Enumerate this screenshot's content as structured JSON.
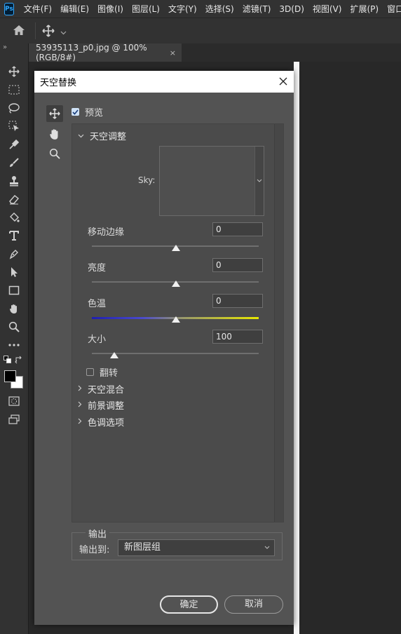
{
  "app": {
    "logo_text": "Ps",
    "menus": [
      "文件(F)",
      "编辑(E)",
      "图像(I)",
      "图层(L)",
      "文字(Y)",
      "选择(S)",
      "滤镜(T)",
      "3D(D)",
      "视图(V)",
      "扩展(P)",
      "窗口(W)"
    ]
  },
  "toolbar": {
    "collapse_glyph": "»",
    "tools": [
      "move-tool",
      "marquee-tool",
      "lasso-tool",
      "object-select-tool",
      "eyedropper-tool",
      "brush-tool",
      "stamp-tool",
      "eraser-tool",
      "paint-bucket-tool",
      "type-tool",
      "pen-tool",
      "path-select-tool",
      "rectangle-tool",
      "hand-tool",
      "zoom-tool",
      "more-tools",
      "quick-mask",
      "screen-mode"
    ],
    "foreground_color": "#000000",
    "background_color": "#ffffff"
  },
  "document": {
    "tab_title": "53935113_p0.jpg @ 100%(RGB/8#)",
    "close_glyph": "×"
  },
  "dialog": {
    "title": "天空替换",
    "close_glyph": "✕",
    "preview_label": "预览",
    "preview_checked": true,
    "sections": {
      "sky_adjust": {
        "label": "天空调整",
        "expanded": true
      },
      "sky_blend": {
        "label": "天空混合"
      },
      "foreground_adjust": {
        "label": "前景调整"
      },
      "tone_options": {
        "label": "色调选项"
      }
    },
    "sky_label": "Sky:",
    "sliders": [
      {
        "label": "移动边缘",
        "value": "0",
        "position": 0.5
      },
      {
        "label": "亮度",
        "value": "0",
        "position": 0.5
      },
      {
        "label": "色温",
        "value": "0",
        "position": 0.5
      },
      {
        "label": "大小",
        "value": "100",
        "position": 0.14
      }
    ],
    "flip_label": "翻转",
    "flip_checked": false,
    "output": {
      "legend": "输出",
      "output_to_label": "输出到:",
      "output_to_value": "新图层组"
    },
    "ok_label": "确定",
    "cancel_label": "取消"
  },
  "colors": {
    "ui_bg": "#323232",
    "dialog_bg": "#535353",
    "temp_gradient_start": "#1f1fb0",
    "temp_gradient_end": "#e8e800"
  }
}
